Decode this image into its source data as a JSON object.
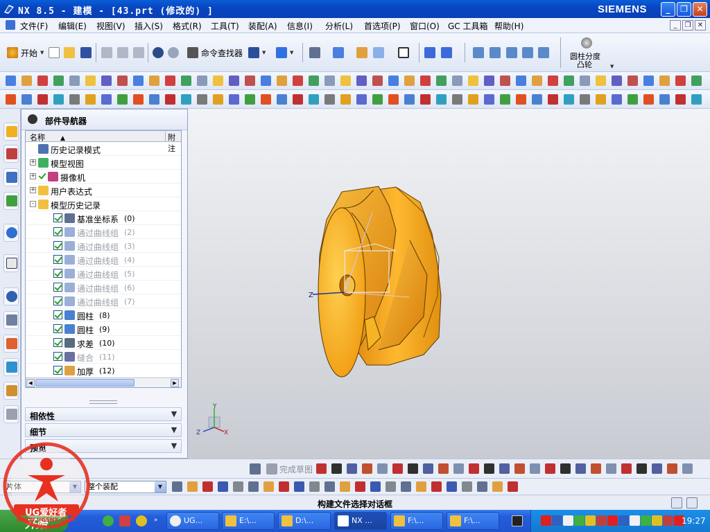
{
  "window": {
    "title": "NX 8.5 - 建模 - [43.prt  (修改的) ]",
    "brand": "SIEMENS",
    "controls": [
      "_",
      "❐",
      "✕"
    ]
  },
  "menu": {
    "items": [
      "文件(F)",
      "编辑(E)",
      "视图(V)",
      "插入(S)",
      "格式(R)",
      "工具(T)",
      "装配(A)",
      "信息(I)",
      "分析(L)",
      "首选项(P)",
      "窗口(O)",
      "GC 工具箱",
      "帮助(H)"
    ],
    "mdi_controls": [
      "_",
      "❐",
      "✕"
    ]
  },
  "toolbar": {
    "start_label": "开始",
    "command_finder_label": "命令查找器",
    "feature_label_line1": "圆柱分度",
    "feature_label_line2": "凸轮"
  },
  "navigator": {
    "title": "部件导航器",
    "col_name": "名称",
    "col_attach": "附注",
    "nodes": [
      {
        "label": "历史记录模式",
        "num": "",
        "expander": "",
        "checked": false,
        "dim": false,
        "level": 0,
        "icon": "clock-icon"
      },
      {
        "label": "模型视图",
        "num": "",
        "expander": "+",
        "checked": false,
        "dim": false,
        "level": 0,
        "icon": "model-views-icon"
      },
      {
        "label": "摄像机",
        "num": "",
        "expander": "+",
        "checked": false,
        "dim": false,
        "level": 0,
        "icon": "camera-icon"
      },
      {
        "label": "用户表达式",
        "num": "",
        "expander": "+",
        "checked": false,
        "dim": false,
        "level": 0,
        "icon": "folder-icon"
      },
      {
        "label": "模型历史记录",
        "num": "",
        "expander": "-",
        "checked": false,
        "dim": false,
        "level": 0,
        "icon": "folder-open-icon"
      },
      {
        "label": "基准坐标系",
        "num": "(0)",
        "expander": "",
        "checked": true,
        "dim": false,
        "level": 1,
        "icon": "datum-csys-icon"
      },
      {
        "label": "通过曲线组",
        "num": "(2)",
        "expander": "",
        "checked": true,
        "dim": true,
        "level": 1,
        "icon": "through-curves-icon"
      },
      {
        "label": "通过曲线组",
        "num": "(3)",
        "expander": "",
        "checked": true,
        "dim": true,
        "level": 1,
        "icon": "through-curves-icon"
      },
      {
        "label": "通过曲线组",
        "num": "(4)",
        "expander": "",
        "checked": true,
        "dim": true,
        "level": 1,
        "icon": "through-curves-icon"
      },
      {
        "label": "通过曲线组",
        "num": "(5)",
        "expander": "",
        "checked": true,
        "dim": true,
        "level": 1,
        "icon": "through-curves-icon"
      },
      {
        "label": "通过曲线组",
        "num": "(6)",
        "expander": "",
        "checked": true,
        "dim": true,
        "level": 1,
        "icon": "through-curves-icon"
      },
      {
        "label": "通过曲线组",
        "num": "(7)",
        "expander": "",
        "checked": true,
        "dim": true,
        "level": 1,
        "icon": "through-curves-icon"
      },
      {
        "label": "圆柱",
        "num": "(8)",
        "expander": "",
        "checked": true,
        "dim": false,
        "level": 1,
        "icon": "cylinder-icon"
      },
      {
        "label": "圆柱",
        "num": "(9)",
        "expander": "",
        "checked": true,
        "dim": false,
        "level": 1,
        "icon": "cylinder-icon"
      },
      {
        "label": "求差",
        "num": "(10)",
        "expander": "",
        "checked": true,
        "dim": false,
        "level": 1,
        "icon": "subtract-icon"
      },
      {
        "label": "缝合",
        "num": "(11)",
        "expander": "",
        "checked": true,
        "dim": true,
        "level": 1,
        "icon": "sew-icon"
      },
      {
        "label": "加厚",
        "num": "(12)",
        "expander": "",
        "checked": true,
        "dim": false,
        "level": 1,
        "icon": "thicken-icon"
      }
    ],
    "panels": [
      "相依性",
      "细节",
      "预览"
    ]
  },
  "sketch_bar": {
    "finish_sketch_label": "完成草图"
  },
  "selection_bar": {
    "filter_value": "片体",
    "scope_value": "整个装配"
  },
  "status": {
    "message": "构建文件选择对话框"
  },
  "viewport": {
    "axis_labels": {
      "z": "Z",
      "y": "Y",
      "x": "X"
    },
    "part_color": "#f0a018"
  },
  "taskbar": {
    "start_label": "开始",
    "tasks": [
      "UG...",
      "E:\\...",
      "D:\\...",
      "NX ...",
      "F:\\...",
      "F:\\..."
    ],
    "clock": "19:27"
  },
  "watermark": {
    "text": "UG爱好者",
    "url": "WWW.UGSNX.COM"
  }
}
